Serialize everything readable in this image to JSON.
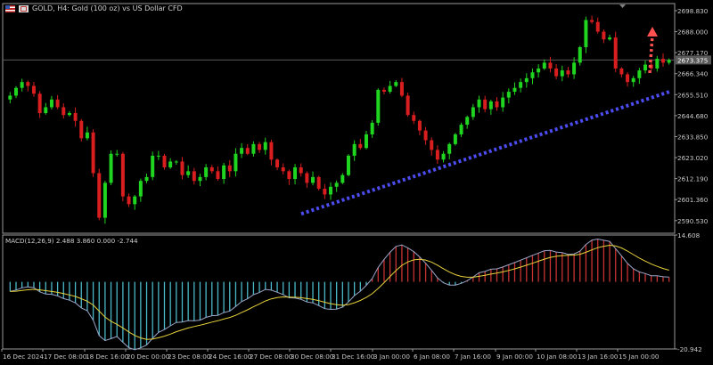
{
  "header": {
    "title": "GOLD, H4:  Gold (100 oz) vs US Dollar CFD"
  },
  "colors": {
    "background": "#000000",
    "up_candle": "#1fd51f",
    "down_candle": "#d81e1e",
    "trendline": "#4c4cf0",
    "arrow": "#ff5050",
    "macd_up": "#c83232",
    "macd_down": "#4ab8c8",
    "signal_line": "#e6d23c",
    "macd_line": "#9aa6c8",
    "grid_line": "#5a5a5a"
  },
  "chart_data": [
    {
      "type": "candlestick",
      "title": "GOLD, H4:  Gold (100 oz) vs US Dollar CFD",
      "y_ticks": [
        "2698.830",
        "2688.000",
        "2677.170",
        "2666.340",
        "2655.510",
        "2644.680",
        "2633.850",
        "2623.020",
        "2612.190",
        "2601.360",
        "2590.530"
      ],
      "ylim": [
        2584.0,
        2702.5
      ],
      "current_price_label": "2673.375",
      "current_price": 2673.375,
      "x_ticks": [
        "16 Dec 2024",
        "17 Dec 08:00",
        "18 Dec 16:00",
        "20 Dec 00:00",
        "23 Dec 08:00",
        "24 Dec 16:00",
        "27 Dec 08:00",
        "30 Dec 08:00",
        "31 Dec 16:00",
        "3 Jan 00:00",
        "6 Jan 08:00",
        "7 Jan 16:00",
        "9 Jan 00:00",
        "10 Jan 08:00",
        "13 Jan 16:00",
        "15 Jan 00:00"
      ],
      "close": [
        2655,
        2659,
        2662,
        2660,
        2656,
        2646,
        2649,
        2653,
        2649,
        2645,
        2646,
        2642,
        2633,
        2636,
        2615,
        2592,
        2610,
        2625,
        2625,
        2603,
        2599,
        2603,
        2611,
        2613,
        2624,
        2624,
        2618,
        2621,
        2621,
        2614,
        2616,
        2611,
        2613,
        2618,
        2616,
        2612,
        2619,
        2616,
        2625,
        2628,
        2625,
        2630,
        2627,
        2631,
        2622,
        2618,
        2616,
        2612,
        2618,
        2615,
        2610,
        2613,
        2607,
        2604,
        2608,
        2610,
        2614,
        2624,
        2630,
        2628,
        2635,
        2641,
        2658,
        2657,
        2660,
        2662,
        2655,
        2645,
        2642,
        2637,
        2632,
        2627,
        2622,
        2625,
        2630,
        2635,
        2640,
        2644,
        2649,
        2653,
        2648,
        2652,
        2649,
        2654,
        2657,
        2659,
        2662,
        2664,
        2667,
        2669,
        2672,
        2669,
        2665,
        2668,
        2666,
        2672,
        2680,
        2694,
        2693,
        2688,
        2684,
        2685,
        2669,
        2666,
        2662,
        2664,
        2668,
        2671,
        2669,
        2674,
        2672,
        2673.375
      ],
      "ylabel": "",
      "xlabel": ""
    },
    {
      "type": "line",
      "title": "MACD(12,26,9) 2.488 3.860 0.000 -2.744",
      "y_ticks": [
        "14.608",
        "-20.942"
      ],
      "ylim": [
        -20.942,
        14.608
      ],
      "series": [
        {
          "name": "MACD(12,26,9)",
          "kind": "histogram"
        },
        {
          "kind": "signal"
        },
        {
          "kind": "line"
        }
      ]
    }
  ],
  "annotations": {
    "trendline": {
      "from_price": 2594,
      "to_price": 2657
    },
    "arrow": "up-arrow"
  }
}
